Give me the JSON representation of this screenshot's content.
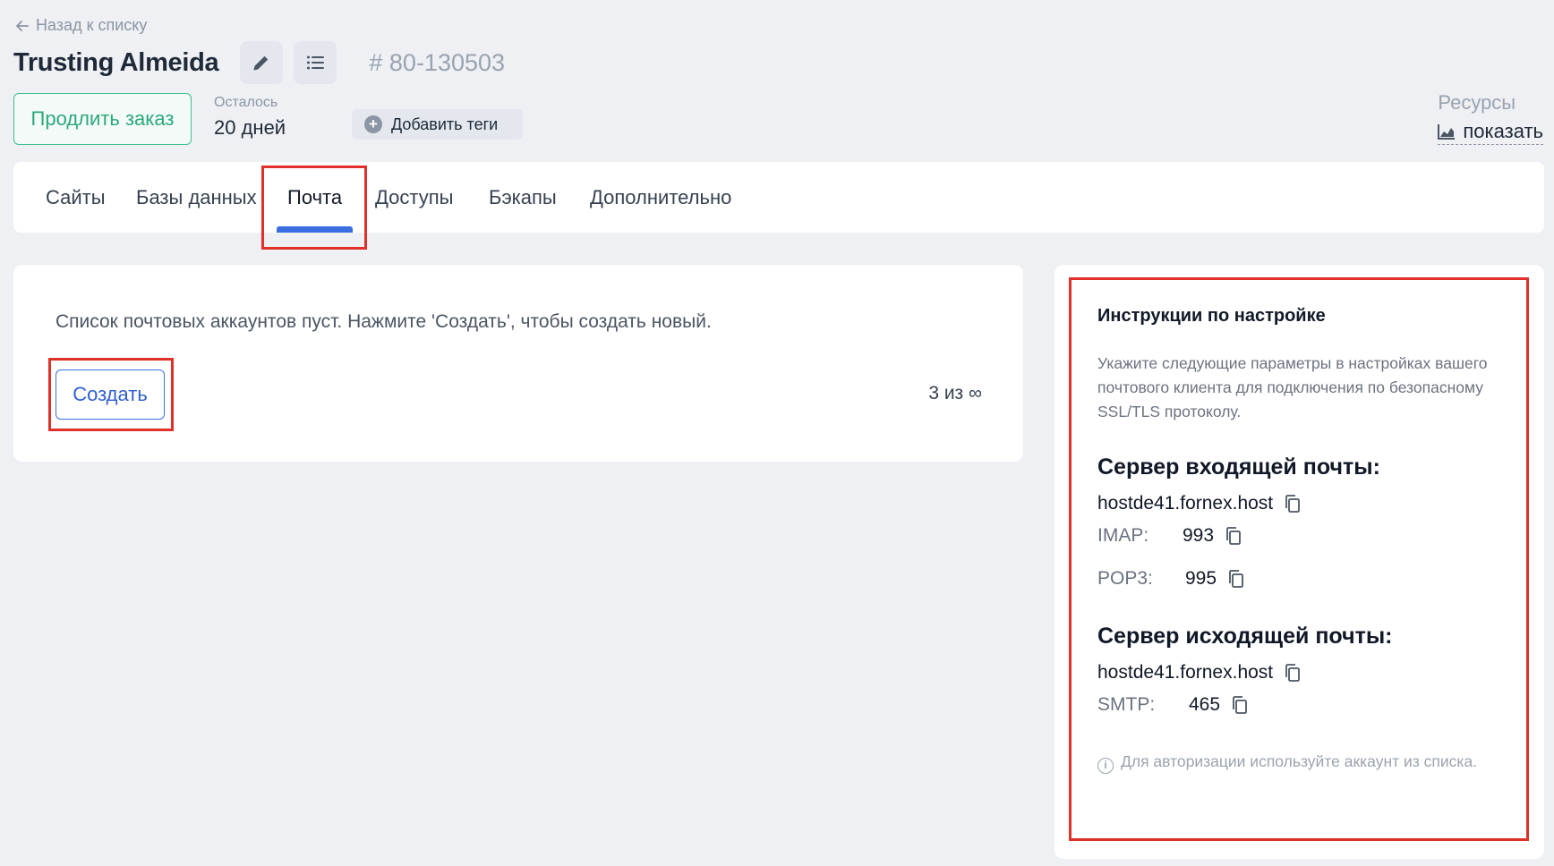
{
  "header": {
    "back_label": "Назад к списку",
    "title": "Trusting Almeida",
    "order_id": "# 80-130503",
    "extend_label": "Продлить заказ",
    "remaining_label": "Осталось",
    "remaining_value": "20 дней",
    "add_tags_label": "Добавить теги",
    "resources_label": "Ресурсы",
    "resources_show": "показать"
  },
  "tabs": [
    {
      "label": "Сайты"
    },
    {
      "label": "Базы данных"
    },
    {
      "label": "Почта"
    },
    {
      "label": "Доступы"
    },
    {
      "label": "Бэкапы"
    },
    {
      "label": "Дополнительно"
    }
  ],
  "active_tab": "Почта",
  "main": {
    "empty_message": "Список почтовых аккаунтов пуст. Нажмите 'Создать', чтобы создать новый.",
    "create_label": "Создать",
    "quota": "3 из ∞"
  },
  "instructions": {
    "title": "Инструкции по настройке",
    "description": "Укажите следующие параметры в настройках вашего почтового клиента для подключения по безопасному SSL/TLS протоколу.",
    "incoming_heading": "Сервер входящей почты:",
    "incoming_host": "hostde41.fornex.host",
    "imap_label": "IMAP:",
    "imap_port": "993",
    "pop3_label": "POP3:",
    "pop3_port": "995",
    "outgoing_heading": "Сервер исходящей почты:",
    "outgoing_host": "hostde41.fornex.host",
    "smtp_label": "SMTP:",
    "smtp_port": "465",
    "note": "Для авторизации используйте аккаунт из списка."
  },
  "colors": {
    "accent_blue": "#3b6fe0",
    "accent_green": "#3fbf8f",
    "highlight_red": "#e0302a",
    "background": "#eef0f4"
  },
  "icons": [
    "arrow-left-icon",
    "pencil-icon",
    "list-icon",
    "plus-circle-icon",
    "chart-icon",
    "copy-icon",
    "info-icon"
  ]
}
